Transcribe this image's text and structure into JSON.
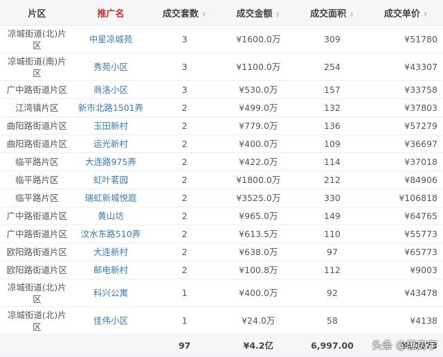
{
  "headers": [
    "片区",
    "推广名",
    "成交套数",
    "成交金额",
    "成交面积",
    "成交单价"
  ],
  "rows": [
    [
      "凉城街道(北)片区",
      "中星凉城苑",
      "3",
      "¥1600.0万",
      "309",
      "¥51780"
    ],
    [
      "凉城街道(南)片区",
      "秀苑小区",
      "3",
      "¥1100.0万",
      "254",
      "¥43307"
    ],
    [
      "广中路街道片区",
      "商洛小区",
      "3",
      "¥530.0万",
      "157",
      "¥33758"
    ],
    [
      "江湾镇片区",
      "新市北路1501弄",
      "2",
      "¥499.0万",
      "132",
      "¥37803"
    ],
    [
      "曲阳路街道片区",
      "玉田新村",
      "2",
      "¥779.0万",
      "136",
      "¥57279"
    ],
    [
      "曲阳路街道片区",
      "运光新村",
      "2",
      "¥400.0万",
      "109",
      "¥36697"
    ],
    [
      "临平路片区",
      "大连路975弄",
      "2",
      "¥422.0万",
      "114",
      "¥37018"
    ],
    [
      "临平路片区",
      "虹叶茗园",
      "2",
      "¥1800.0万",
      "212",
      "¥84906"
    ],
    [
      "临平路片区",
      "瑞虹新城悦庭",
      "2",
      "¥3525.0万",
      "330",
      "¥106818"
    ],
    [
      "广中路街道片区",
      "黄山坊",
      "2",
      "¥965.0万",
      "149",
      "¥64765"
    ],
    [
      "广中路街道片区",
      "汶水东路510弄",
      "2",
      "¥613.5万",
      "110",
      "¥55773"
    ],
    [
      "欧阳路街道片区",
      "大连新村",
      "2",
      "¥638.0万",
      "97",
      "¥65773"
    ],
    [
      "欧阳路街道片区",
      "邮电新村",
      "2",
      "¥100.8万",
      "112",
      "¥9003"
    ],
    [
      "凉城街道(北)片区",
      "科兴公寓",
      "1",
      "¥400.0万",
      "92",
      "¥43478"
    ],
    [
      "凉城街道(北)片区",
      "佳伟小区",
      "1",
      "¥24.0万",
      "58",
      "¥4138"
    ]
  ],
  "footer": {
    "count": "97",
    "amount": "¥4.2亿",
    "area": "6,997.00",
    "price": "¥60073"
  },
  "watermark": "头条 @惠房宇"
}
